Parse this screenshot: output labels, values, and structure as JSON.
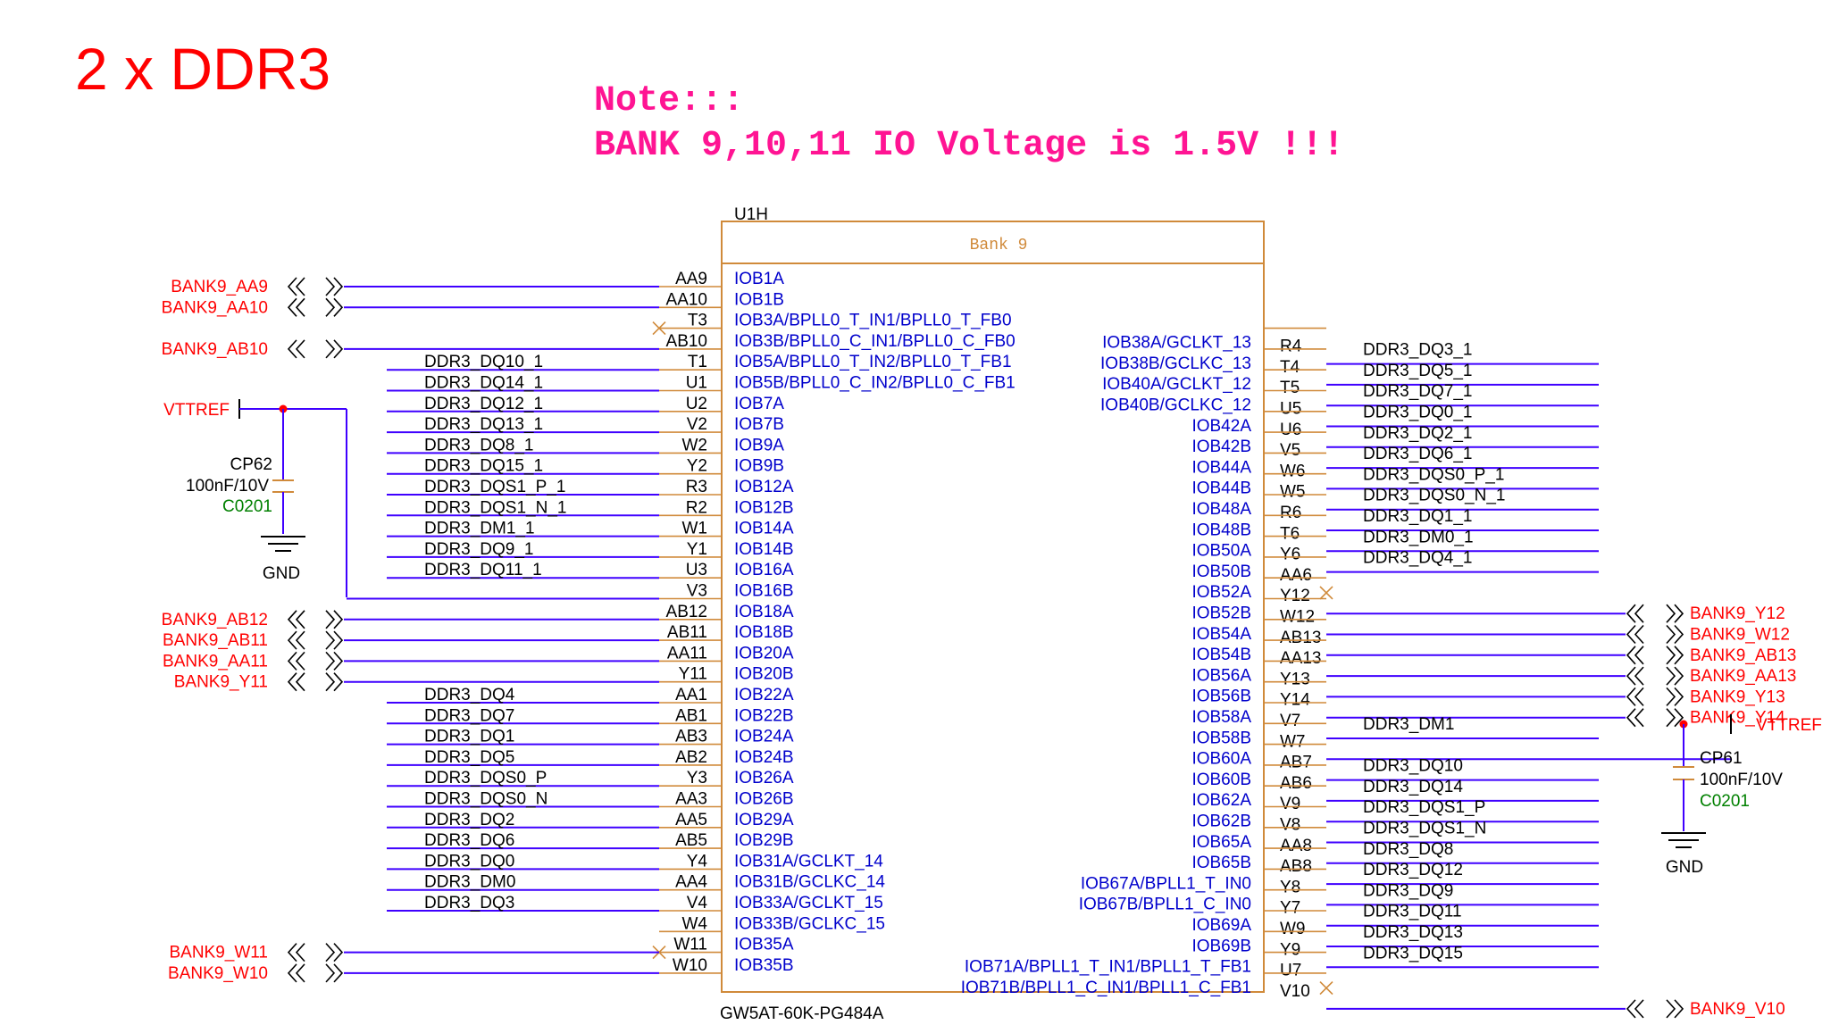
{
  "title": "2 x DDR3",
  "note": {
    "line1": "Note:::",
    "line2": "BANK 9,10,11 IO Voltage is 1.5V !!!"
  },
  "component": {
    "refdes": "U1H",
    "bank": "Bank 9",
    "part": "GW5AT-60K-PG484A"
  },
  "left_pins": [
    {
      "pin": "AA9",
      "name": "IOB1A",
      "net": "BANK9_AA9",
      "kind": "port"
    },
    {
      "pin": "AA10",
      "name": "IOB1B",
      "net": "BANK9_AA10",
      "kind": "port"
    },
    {
      "pin": "T3",
      "name": "IOB3A/BPLL0_T_IN1/BPLL0_T_FB0",
      "net": "",
      "kind": "nc"
    },
    {
      "pin": "AB10",
      "name": "IOB3B/BPLL0_C_IN1/BPLL0_C_FB0",
      "net": "BANK9_AB10",
      "kind": "port"
    },
    {
      "pin": "T1",
      "name": "IOB5A/BPLL0_T_IN2/BPLL0_T_FB1",
      "net": "DDR3_DQ10_1",
      "kind": "net"
    },
    {
      "pin": "U1",
      "name": "IOB5B/BPLL0_C_IN2/BPLL0_C_FB1",
      "net": "DDR3_DQ14_1",
      "kind": "net"
    },
    {
      "pin": "U2",
      "name": "IOB7A",
      "net": "DDR3_DQ12_1",
      "kind": "net"
    },
    {
      "pin": "V2",
      "name": "IOB7B",
      "net": "DDR3_DQ13_1",
      "kind": "net"
    },
    {
      "pin": "W2",
      "name": "IOB9A",
      "net": "DDR3_DQ8_1",
      "kind": "net"
    },
    {
      "pin": "Y2",
      "name": "IOB9B",
      "net": "DDR3_DQ15_1",
      "kind": "net"
    },
    {
      "pin": "R3",
      "name": "IOB12A",
      "net": "DDR3_DQS1_P_1",
      "kind": "net"
    },
    {
      "pin": "R2",
      "name": "IOB12B",
      "net": "DDR3_DQS1_N_1",
      "kind": "net"
    },
    {
      "pin": "W1",
      "name": "IOB14A",
      "net": "DDR3_DM1_1",
      "kind": "net"
    },
    {
      "pin": "Y1",
      "name": "IOB14B",
      "net": "DDR3_DQ9_1",
      "kind": "net"
    },
    {
      "pin": "U3",
      "name": "IOB16A",
      "net": "DDR3_DQ11_1",
      "kind": "net"
    },
    {
      "pin": "V3",
      "name": "IOB16B",
      "net": "VTTREF",
      "kind": "vtt"
    },
    {
      "pin": "AB12",
      "name": "IOB18A",
      "net": "BANK9_AB12",
      "kind": "port"
    },
    {
      "pin": "AB11",
      "name": "IOB18B",
      "net": "BANK9_AB11",
      "kind": "port"
    },
    {
      "pin": "AA11",
      "name": "IOB20A",
      "net": "BANK9_AA11",
      "kind": "port"
    },
    {
      "pin": "Y11",
      "name": "IOB20B",
      "net": "BANK9_Y11",
      "kind": "port"
    },
    {
      "pin": "AA1",
      "name": "IOB22A",
      "net": "DDR3_DQ4",
      "kind": "net"
    },
    {
      "pin": "AB1",
      "name": "IOB22B",
      "net": "DDR3_DQ7",
      "kind": "net"
    },
    {
      "pin": "AB3",
      "name": "IOB24A",
      "net": "DDR3_DQ1",
      "kind": "net"
    },
    {
      "pin": "AB2",
      "name": "IOB24B",
      "net": "DDR3_DQ5",
      "kind": "net"
    },
    {
      "pin": "Y3",
      "name": "IOB26A",
      "net": "DDR3_DQS0_P",
      "kind": "net"
    },
    {
      "pin": "AA3",
      "name": "IOB26B",
      "net": "DDR3_DQS0_N",
      "kind": "net"
    },
    {
      "pin": "AA5",
      "name": "IOB29A",
      "net": "DDR3_DQ2",
      "kind": "net"
    },
    {
      "pin": "AB5",
      "name": "IOB29B",
      "net": "DDR3_DQ6",
      "kind": "net"
    },
    {
      "pin": "Y4",
      "name": "IOB31A/GCLKT_14",
      "net": "DDR3_DQ0",
      "kind": "net"
    },
    {
      "pin": "AA4",
      "name": "IOB31B/GCLKC_14",
      "net": "DDR3_DM0",
      "kind": "net"
    },
    {
      "pin": "V4",
      "name": "IOB33A/GCLKT_15",
      "net": "DDR3_DQ3",
      "kind": "net"
    },
    {
      "pin": "W4",
      "name": "IOB33B/GCLKC_15",
      "net": "",
      "kind": "stub"
    },
    {
      "pin": "W11",
      "name": "IOB35A",
      "net": "BANK9_W11",
      "kind": "port"
    },
    {
      "pin": "W10",
      "name": "IOB35B",
      "net": "BANK9_W10",
      "kind": "port"
    }
  ],
  "right_pins": [
    {
      "pin": "",
      "name": "",
      "net": "",
      "kind": "none"
    },
    {
      "pin": "",
      "name": "",
      "net": "",
      "kind": "none"
    },
    {
      "pin": "R4",
      "name": "IOB38A/GCLKT_13",
      "net": "DDR3_DQ3_1",
      "kind": "net"
    },
    {
      "pin": "T4",
      "name": "IOB38B/GCLKC_13",
      "net": "DDR3_DQ5_1",
      "kind": "net"
    },
    {
      "pin": "T5",
      "name": "IOB40A/GCLKT_12",
      "net": "DDR3_DQ7_1",
      "kind": "net"
    },
    {
      "pin": "U5",
      "name": "IOB40B/GCLKC_12",
      "net": "DDR3_DQ0_1",
      "kind": "net"
    },
    {
      "pin": "U6",
      "name": "IOB42A",
      "net": "DDR3_DQ2_1",
      "kind": "net"
    },
    {
      "pin": "V5",
      "name": "IOB42B",
      "net": "DDR3_DQ6_1",
      "kind": "net"
    },
    {
      "pin": "W6",
      "name": "IOB44A",
      "net": "DDR3_DQS0_P_1",
      "kind": "net"
    },
    {
      "pin": "W5",
      "name": "IOB44B",
      "net": "DDR3_DQS0_N_1",
      "kind": "net"
    },
    {
      "pin": "R6",
      "name": "IOB48A",
      "net": "DDR3_DQ1_1",
      "kind": "net"
    },
    {
      "pin": "T6",
      "name": "IOB48B",
      "net": "DDR3_DM0_1",
      "kind": "net"
    },
    {
      "pin": "Y6",
      "name": "IOB50A",
      "net": "DDR3_DQ4_1",
      "kind": "net"
    },
    {
      "pin": "AA6",
      "name": "IOB50B",
      "net": "",
      "kind": "nc"
    },
    {
      "pin": "Y12",
      "name": "IOB52A",
      "net": "BANK9_Y12",
      "kind": "port"
    },
    {
      "pin": "W12",
      "name": "IOB52B",
      "net": "BANK9_W12",
      "kind": "port"
    },
    {
      "pin": "AB13",
      "name": "IOB54A",
      "net": "BANK9_AB13",
      "kind": "port"
    },
    {
      "pin": "AA13",
      "name": "IOB54B",
      "net": "BANK9_AA13",
      "kind": "port"
    },
    {
      "pin": "Y13",
      "name": "IOB56A",
      "net": "BANK9_Y13",
      "kind": "port"
    },
    {
      "pin": "Y14",
      "name": "IOB56B",
      "net": "BANK9_Y14",
      "kind": "port"
    },
    {
      "pin": "V7",
      "name": "IOB58A",
      "net": "DDR3_DM1",
      "kind": "net"
    },
    {
      "pin": "W7",
      "name": "IOB58B",
      "net": "VTTREF",
      "kind": "vtt"
    },
    {
      "pin": "AB7",
      "name": "IOB60A",
      "net": "DDR3_DQ10",
      "kind": "net"
    },
    {
      "pin": "AB6",
      "name": "IOB60B",
      "net": "DDR3_DQ14",
      "kind": "net"
    },
    {
      "pin": "V9",
      "name": "IOB62A",
      "net": "DDR3_DQS1_P",
      "kind": "net"
    },
    {
      "pin": "V8",
      "name": "IOB62B",
      "net": "DDR3_DQS1_N",
      "kind": "net"
    },
    {
      "pin": "AA8",
      "name": "IOB65A",
      "net": "DDR3_DQ8",
      "kind": "net"
    },
    {
      "pin": "AB8",
      "name": "IOB65B",
      "net": "DDR3_DQ12",
      "kind": "net"
    },
    {
      "pin": "Y8",
      "name": "IOB67A/BPLL1_T_IN0",
      "net": "DDR3_DQ9",
      "kind": "net"
    },
    {
      "pin": "Y7",
      "name": "IOB67B/BPLL1_C_IN0",
      "net": "DDR3_DQ11",
      "kind": "net"
    },
    {
      "pin": "W9",
      "name": "IOB69A",
      "net": "DDR3_DQ13",
      "kind": "net"
    },
    {
      "pin": "Y9",
      "name": "IOB69B",
      "net": "DDR3_DQ15",
      "kind": "net"
    },
    {
      "pin": "U7",
      "name": "IOB71A/BPLL1_T_IN1/BPLL1_T_FB1",
      "net": "",
      "kind": "nc"
    },
    {
      "pin": "V10",
      "name": "IOB71B/BPLL1_C_IN1/BPLL1_C_FB1",
      "net": "BANK9_V10",
      "kind": "port"
    }
  ],
  "left_cap": {
    "power": "VTTREF",
    "ref": "CP62",
    "value": "100nF/10V",
    "footprint": "C0201",
    "gnd": "GND"
  },
  "right_cap": {
    "power": "VTTREF",
    "ref": "CP61",
    "value": "100nF/10V",
    "footprint": "C0201",
    "gnd": "GND"
  },
  "colors": {
    "title": "#ff0000",
    "note": "#ff1493",
    "wire": "#3f00ff",
    "pin_name": "#0000cc",
    "box": "#d08a3a",
    "green": "#008000",
    "black": "#000000"
  }
}
